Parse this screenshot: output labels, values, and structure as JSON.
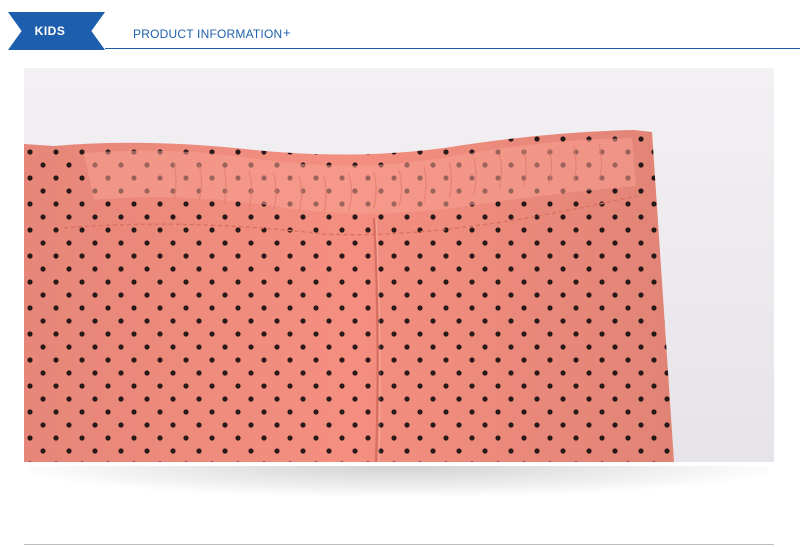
{
  "header": {
    "badge_label": "KIDS",
    "section_title": "PRODUCT INFORMATION",
    "plus_icon": "+"
  },
  "product_photo": {
    "subject": "pink polka-dot kids pants waistband",
    "fabric_color": "#f48f80",
    "dot_color": "#2a1a1a",
    "background_color": "#efedf0"
  },
  "colors": {
    "accent": "#1e5fad"
  }
}
